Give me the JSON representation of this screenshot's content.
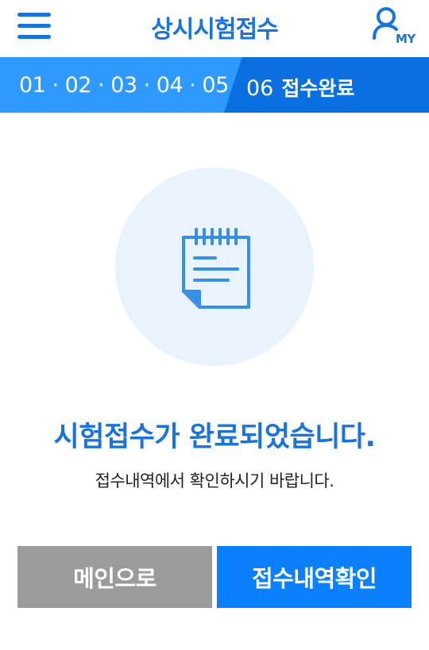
{
  "header": {
    "title": "상시시험접수",
    "my_label": "MY"
  },
  "steps": {
    "completed": "01 · 02 · 03 · 04 · 05",
    "current_number": "06",
    "current_label": "접수완료"
  },
  "result": {
    "title": "시험접수가 완료되었습니다.",
    "subtitle": "접수내역에서 확인하시기 바랍니다."
  },
  "buttons": {
    "main_label": "메인으로",
    "check_label": "접수내역확인"
  },
  "colors": {
    "primary": "#1a73d9",
    "step_bar": "#2e9aff",
    "step_current": "#0b6fe0",
    "icon_circle": "#e8f3fd",
    "button_gray": "#9b9b9b",
    "button_blue": "#0b80ff"
  }
}
